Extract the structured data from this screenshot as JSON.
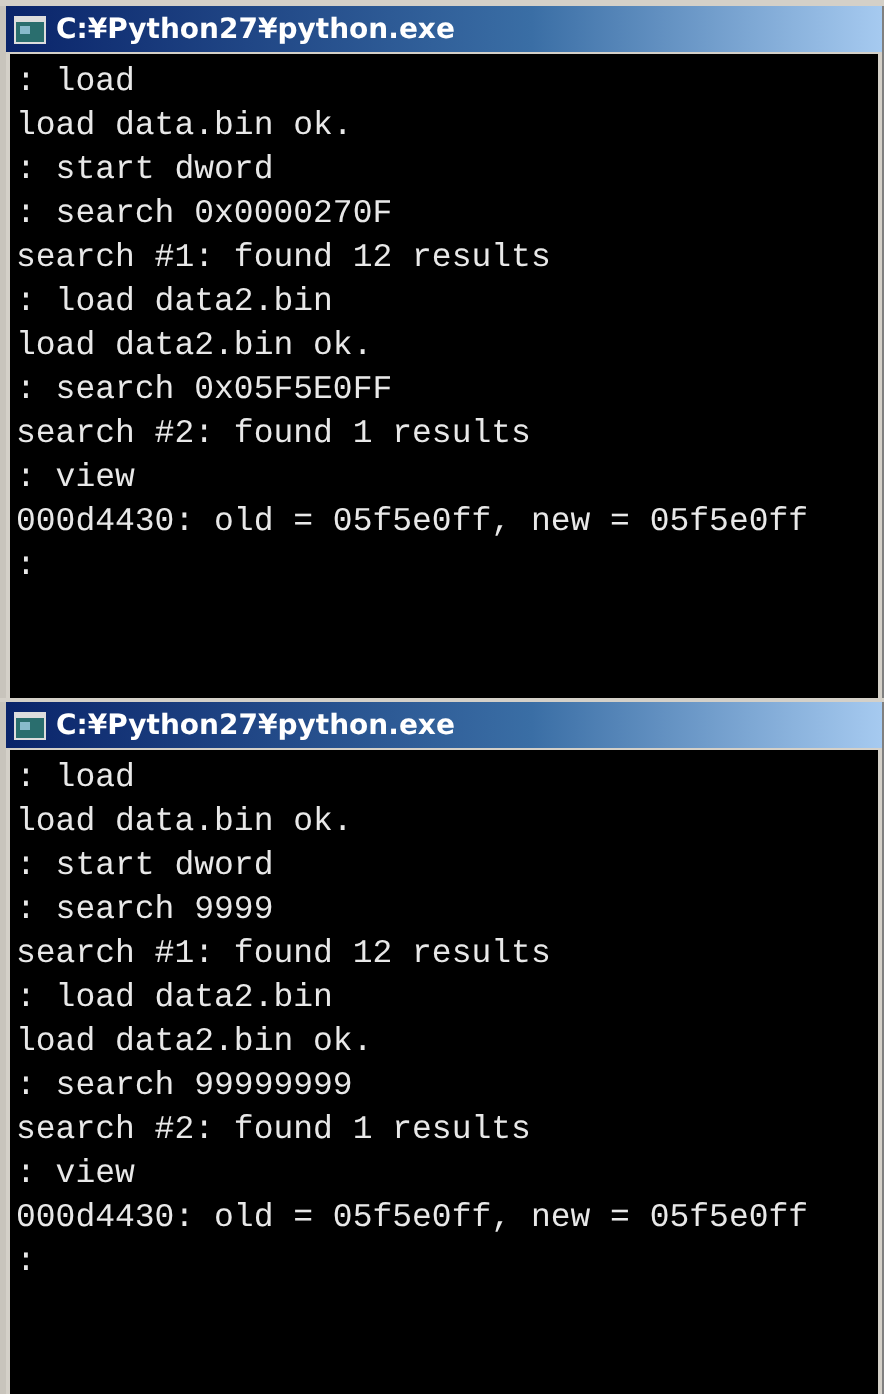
{
  "windows": [
    {
      "title": "C:¥Python27¥python.exe",
      "lines": [
        ": load",
        "load data.bin ok.",
        ": start dword",
        ": search 0x0000270F",
        "search #1: found 12 results",
        ": load data2.bin",
        "load data2.bin ok.",
        ": search 0x05F5E0FF",
        "search #2: found 1 results",
        ": view",
        "000d4430: old = 05f5e0ff, new = 05f5e0ff",
        ":"
      ]
    },
    {
      "title": "C:¥Python27¥python.exe",
      "lines": [
        ": load",
        "load data.bin ok.",
        ": start dword",
        ": search 9999",
        "search #1: found 12 results",
        ": load data2.bin",
        "load data2.bin ok.",
        ": search 99999999",
        "search #2: found 1 results",
        ": view",
        "000d4430: old = 05f5e0ff, new = 05f5e0ff",
        ":"
      ]
    }
  ]
}
